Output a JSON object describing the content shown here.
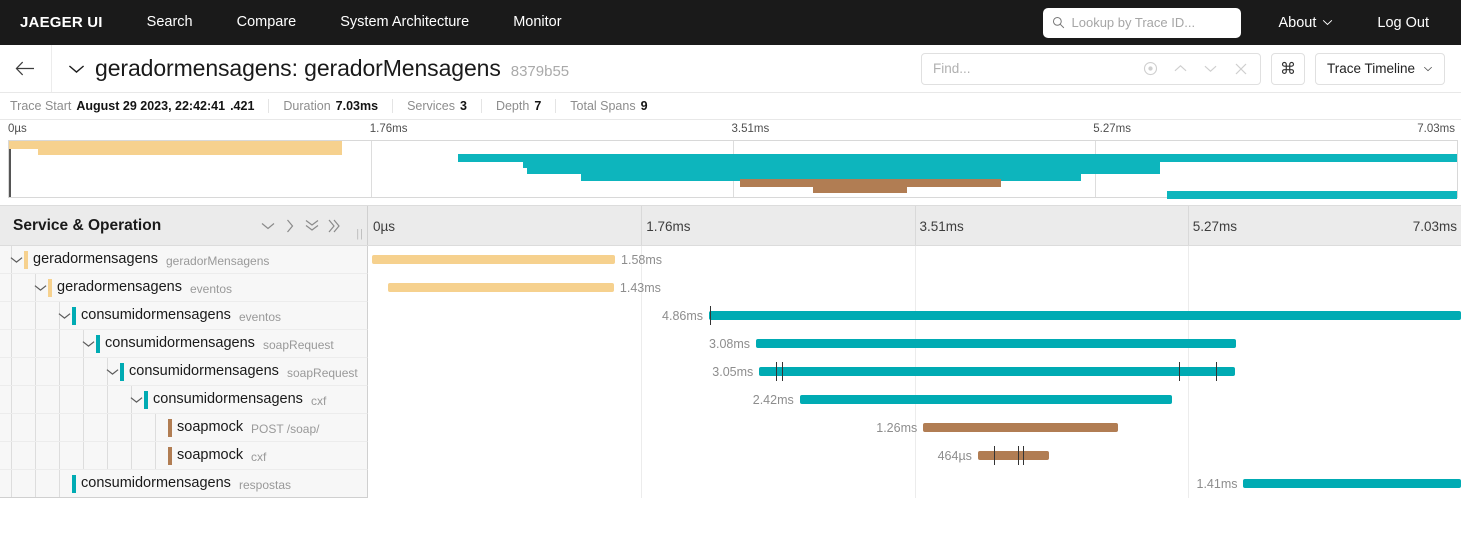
{
  "nav": {
    "brand": "JAEGER UI",
    "items": [
      "Search",
      "Compare",
      "System Architecture",
      "Monitor"
    ],
    "lookup_placeholder": "Lookup by Trace ID...",
    "about_label": "About",
    "logout_label": "Log Out"
  },
  "title": {
    "service_operation": "geradormensagens: geradorMensagens",
    "trace_id": "8379b55",
    "find_placeholder": "Find...",
    "kbd_label": "⌘",
    "view_selector": "Trace Timeline"
  },
  "summary": {
    "trace_start_label": "Trace Start",
    "trace_start_value": "August 29 2023, 22:42:41",
    "trace_start_fraction": ".421",
    "duration_label": "Duration",
    "duration_value": "7.03ms",
    "services_label": "Services",
    "services_value": "3",
    "depth_label": "Depth",
    "depth_value": "7",
    "total_spans_label": "Total Spans",
    "total_spans_value": "9"
  },
  "axis": {
    "ticks": [
      "0µs",
      "1.76ms",
      "3.51ms",
      "5.27ms",
      "7.03ms"
    ],
    "total_duration_ms": 7.03
  },
  "table_header": {
    "column_title": "Service & Operation",
    "controls": [
      "chevron-down-icon",
      "chevron-right-icon",
      "chevrons-down-icon",
      "chevrons-right-icon"
    ]
  },
  "colors": {
    "orange": "#f6d18e",
    "orange_dark": "#f5c97c",
    "teal": "#00ABB3",
    "brown": "#b17d53",
    "nav_bg": "#1a1a1a",
    "header_bg": "#ebebeb",
    "row_bg": "#f7f7f7"
  },
  "minimap_bars": [
    {
      "start_pct": 0.0,
      "end_pct": 23.0,
      "color": "#f6d18e"
    },
    {
      "start_pct": 2.0,
      "end_pct": 23.0,
      "color": "#f6d18e"
    },
    {
      "start_pct": 31.0,
      "end_pct": 100.0,
      "color": "#0db5bd"
    },
    {
      "start_pct": 35.5,
      "end_pct": 79.5,
      "color": "#0db5bd"
    },
    {
      "start_pct": 35.8,
      "end_pct": 79.5,
      "color": "#0db5bd"
    },
    {
      "start_pct": 39.5,
      "end_pct": 74.0,
      "color": "#0db5bd"
    },
    {
      "start_pct": 50.5,
      "end_pct": 68.5,
      "color": "#b17d53"
    },
    {
      "start_pct": 55.5,
      "end_pct": 62.0,
      "color": "#b17d53"
    },
    {
      "start_pct": 80.0,
      "end_pct": 100.0,
      "color": "#0db5bd"
    }
  ],
  "spans": [
    {
      "service": "geradormensagens",
      "operation": "geradorMensagens",
      "depth": 0,
      "has_caret": true,
      "color": "#f6d18e",
      "duration_label": "1.58ms",
      "start_pct": 0.4,
      "end_pct": 22.6,
      "label_side": "right",
      "logs_pct": []
    },
    {
      "service": "geradormensagens",
      "operation": "eventos",
      "depth": 1,
      "has_caret": true,
      "color": "#f6d18e",
      "duration_label": "1.43ms",
      "start_pct": 1.8,
      "end_pct": 22.5,
      "label_side": "right",
      "logs_pct": []
    },
    {
      "service": "consumidormensagens",
      "operation": "eventos",
      "depth": 2,
      "has_caret": true,
      "color": "#00ABB3",
      "duration_label": "4.86ms",
      "start_pct": 31.2,
      "end_pct": 100.0,
      "label_side": "left",
      "logs_pct": [
        31.3
      ]
    },
    {
      "service": "consumidormensagens",
      "operation": "soapRequest",
      "depth": 3,
      "has_caret": true,
      "color": "#00ABB3",
      "duration_label": "3.08ms",
      "start_pct": 35.5,
      "end_pct": 79.4,
      "label_side": "left",
      "logs_pct": []
    },
    {
      "service": "consumidormensagens",
      "operation": "soapRequest",
      "depth": 4,
      "has_caret": true,
      "color": "#00ABB3",
      "duration_label": "3.05ms",
      "start_pct": 35.8,
      "end_pct": 79.3,
      "label_side": "left",
      "logs_pct": [
        37.3,
        37.9,
        74.2,
        77.6
      ]
    },
    {
      "service": "consumidormensagens",
      "operation": "cxf",
      "depth": 5,
      "has_caret": true,
      "color": "#00ABB3",
      "duration_label": "2.42ms",
      "start_pct": 39.5,
      "end_pct": 73.6,
      "label_side": "left",
      "logs_pct": []
    },
    {
      "service": "soapmock",
      "operation": "POST /soap/",
      "depth": 6,
      "has_caret": false,
      "color": "#b17d53",
      "duration_label": "1.26ms",
      "start_pct": 50.8,
      "end_pct": 68.6,
      "label_side": "left",
      "logs_pct": []
    },
    {
      "service": "soapmock",
      "operation": "cxf",
      "depth": 6,
      "has_caret": false,
      "color": "#b17d53",
      "duration_label": "464µs",
      "start_pct": 55.8,
      "end_pct": 62.3,
      "label_side": "left",
      "logs_pct": [
        57.3,
        59.5,
        59.9
      ]
    },
    {
      "service": "consumidormensagens",
      "operation": "respostas",
      "depth": 2,
      "has_caret": false,
      "color": "#00ABB3",
      "duration_label": "1.41ms",
      "start_pct": 80.1,
      "end_pct": 100.0,
      "label_side": "left",
      "logs_pct": []
    }
  ]
}
